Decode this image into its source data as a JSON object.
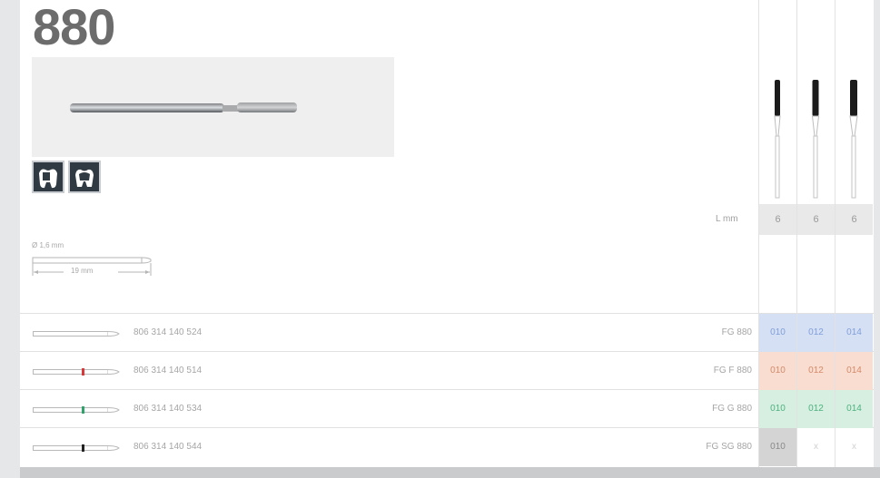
{
  "product": {
    "title": "880"
  },
  "diagram": {
    "diameter_label": "Ø 1,6 mm",
    "length_label": "19 mm"
  },
  "size_table": {
    "length_label": "L mm",
    "length_values": [
      "6",
      "6",
      "6"
    ]
  },
  "rows": [
    {
      "code": "806 314 140 524",
      "name": "FG 880",
      "stripe_color": "",
      "cell_color": "#d6e0f5",
      "sizes": [
        "010",
        "012",
        "014"
      ],
      "size_colors": [
        "#7f9fd8",
        "#7f9fd8",
        "#7f9fd8"
      ]
    },
    {
      "code": "806 314 140 514",
      "name": "FG F 880",
      "stripe_color": "#d8383a",
      "cell_color": "#f8ddd0",
      "sizes": [
        "010",
        "012",
        "014"
      ],
      "size_colors": [
        "#d58a6a",
        "#d58a6a",
        "#d58a6a"
      ]
    },
    {
      "code": "806 314 140 534",
      "name": "FG G 880",
      "stripe_color": "#2fa36b",
      "cell_color": "#d6efe1",
      "sizes": [
        "010",
        "012",
        "014"
      ],
      "size_colors": [
        "#4db27e",
        "#4db27e",
        "#4db27e"
      ]
    },
    {
      "code": "806 314 140 544",
      "name": "FG SG 880",
      "stripe_color": "#222222",
      "cell_color": "#d4d4d4",
      "sizes": [
        "010",
        "x",
        "x"
      ],
      "size_colors": [
        "#8a8a8a",
        "#d0d0d0",
        "#d0d0d0"
      ]
    }
  ]
}
